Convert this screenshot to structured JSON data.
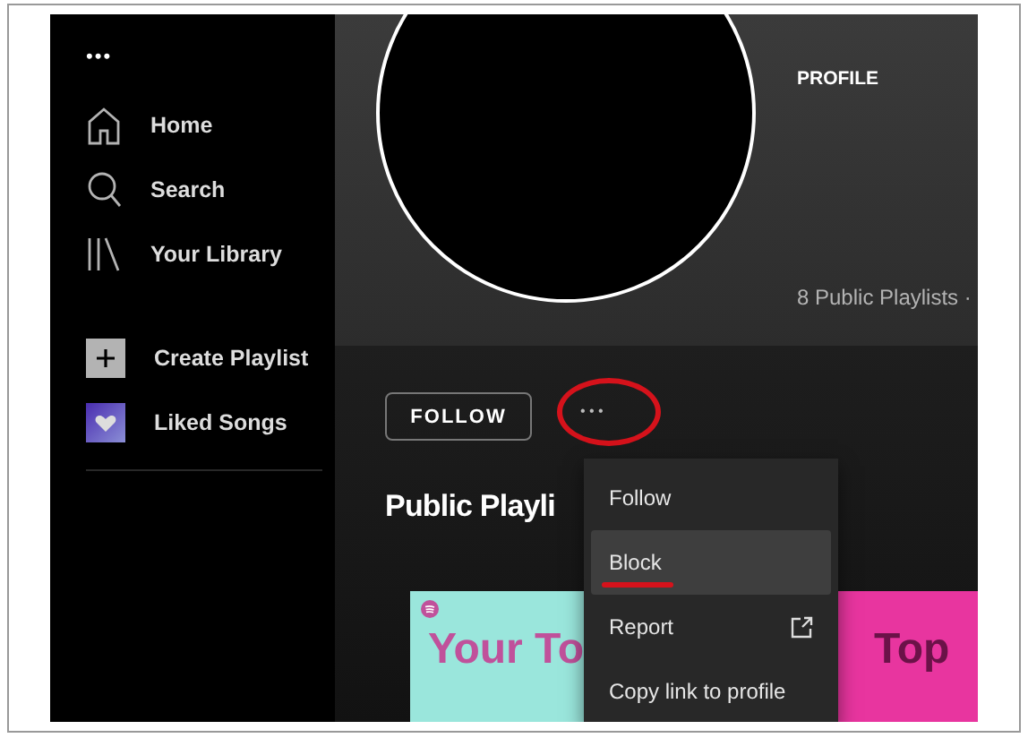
{
  "sidebar": {
    "more": "•••",
    "nav": [
      {
        "kind": "home",
        "label": "Home"
      },
      {
        "kind": "search",
        "label": "Search"
      },
      {
        "kind": "library",
        "label": "Your Library"
      }
    ],
    "playlists": [
      {
        "kind": "create",
        "label": "Create Playlist"
      },
      {
        "kind": "liked",
        "label": "Liked Songs"
      }
    ]
  },
  "header": {
    "type_label": "PROFILE",
    "subtitle": "8 Public Playlists ·"
  },
  "actions": {
    "follow": "FOLLOW",
    "more": "• • •",
    "more_circled": true
  },
  "section": {
    "title": "Public Playli"
  },
  "cards": [
    {
      "title": "Your To",
      "color": "#9ae6dc"
    },
    {
      "title": "Top",
      "color": "#e8359f"
    }
  ],
  "menu": [
    {
      "label": "Follow",
      "highlighted": false,
      "underlined": false,
      "external": false
    },
    {
      "label": "Block",
      "highlighted": true,
      "underlined": true,
      "external": false
    },
    {
      "label": "Report",
      "highlighted": false,
      "underlined": false,
      "external": true
    },
    {
      "label": "Copy link to profile",
      "highlighted": false,
      "underlined": false,
      "external": false
    }
  ]
}
